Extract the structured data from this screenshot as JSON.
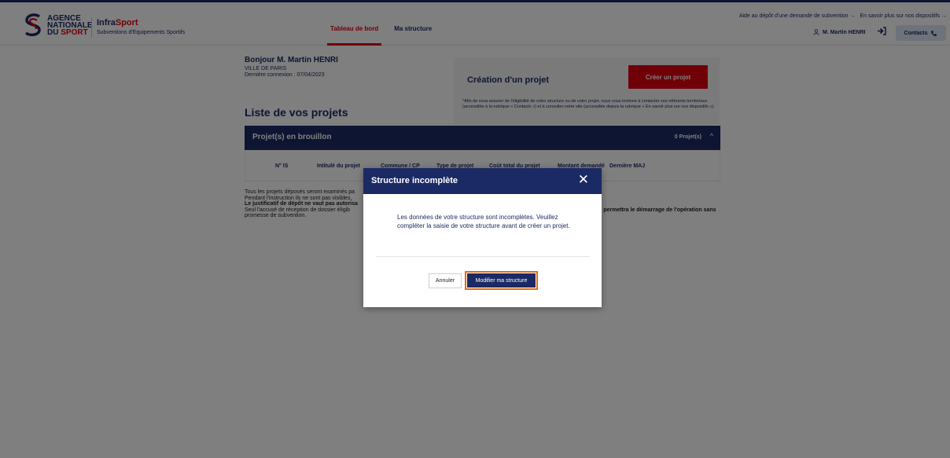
{
  "header": {
    "logo_line1": "AGENCE",
    "logo_line2": "NATIONALE",
    "logo_line3_a": "DU ",
    "logo_line3_b": "SPORT",
    "brand_a": "Infra",
    "brand_b": "Sport",
    "brand_sub": "Subventions d'Equipements Sportifs",
    "nav": [
      "Tableau de bord",
      "Ma structure"
    ],
    "top_link_1": "Aide au dépôt d'une demande de subvention",
    "top_link_2": "En savoir plus sur nos dispositifs",
    "user_name": "M. Martin HENRI",
    "contacts_label": "Contacts"
  },
  "greeting": {
    "title": "Bonjour M. Martin HENRI",
    "org": "VILLE DE PARIS",
    "last_login": "Dernière connexion : 07/04/2023"
  },
  "create": {
    "title": "Création d'un projet",
    "button": "Créer un projet",
    "note": "*Afin de vous assurer de l'éligibilité de votre structure ou de votre projet, nous vous invitons à contacter vos référents territoriaux (accessible à la rubrique « Contacts ») et à consulter notre site (accessible depuis la rubrique « En savoir plus sur nos dispositifs »)."
  },
  "projects": {
    "title": "Liste de vos projets",
    "draft_title": "Projet(s) en brouillon",
    "draft_count": "0 Projet(s)",
    "columns": [
      "N° IS",
      "Intitulé du projet",
      "Commune / CP",
      "Type de projet",
      "Coût total du projet",
      "Montant demandé",
      "Dernière MAJ"
    ]
  },
  "info": {
    "line1": "Tous les projets déposés seront examinés pa",
    "line2": "Pendant l'instruction ils ne sont pas visibles,",
    "line3": "Le justificatif de dépôt ne vaut pas autorisa",
    "line4a": "Seul l'accusé de réception de dossier éligib",
    "line4b": "n permettra le démarrage de l'opération sans",
    "line5": "promesse de subvention."
  },
  "modal": {
    "title": "Structure incomplète",
    "close": "✕",
    "message": "Les données de votre structure sont incomplètes. Veuillez compléter la saisie de votre structure avant de créer un projet.",
    "cancel": "Annuler",
    "confirm": "Modifier ma structure"
  },
  "colors": {
    "navy": "#1b2a64",
    "red": "#e1000f",
    "highlight": "#e06a1b"
  }
}
